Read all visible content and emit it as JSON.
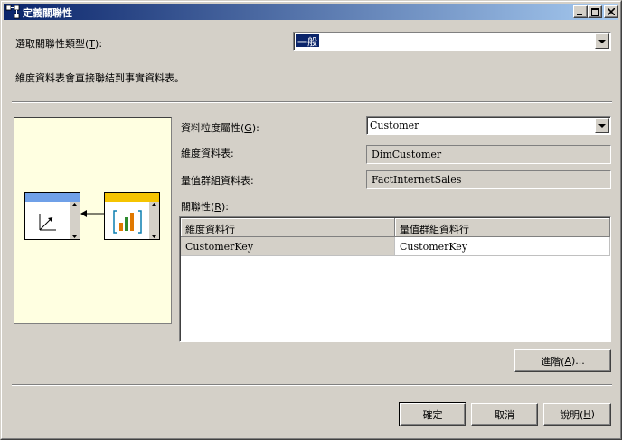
{
  "window": {
    "title": "定義關聯性",
    "title_icon": "relationship-icon"
  },
  "relationship_type": {
    "label_prefix": "選取關聯性類型(",
    "label_key": "T",
    "label_suffix": "):",
    "value": "一般"
  },
  "description": "維度資料表會直接聯結到事實資料表。",
  "granularity": {
    "label_prefix": "資料粒度屬性(",
    "label_key": "G",
    "label_suffix": "):",
    "value": "Customer"
  },
  "dimension_table": {
    "label": "維度資料表:",
    "value": "DimCustomer"
  },
  "measure_group_table": {
    "label": "量值群組資料表:",
    "value": "FactInternetSales"
  },
  "relationship_grid": {
    "label_prefix": "關聯性(",
    "label_key": "R",
    "label_suffix": "):",
    "columns": [
      "維度資料行",
      "量值群組資料行"
    ],
    "rows": [
      [
        "CustomerKey",
        "CustomerKey"
      ]
    ]
  },
  "buttons": {
    "advanced": {
      "prefix": "進階(",
      "key": "A",
      "suffix": ")..."
    },
    "ok": "確定",
    "cancel": "取消",
    "help": {
      "prefix": "說明(",
      "key": "H",
      "suffix": ")"
    }
  },
  "colors": {
    "title_start": "#0a246a",
    "title_end": "#a6caf0",
    "dialog_bg": "#d4d0c8",
    "diagram_bg": "#ffffe1",
    "dimension_header": "#6fa0e8",
    "fact_header": "#f5c400"
  },
  "icons": [
    "minimize-icon",
    "maximize-icon",
    "close-icon",
    "dropdown-arrow-icon",
    "dimension-table-icon",
    "fact-table-icon",
    "relationship-arrow-icon"
  ]
}
